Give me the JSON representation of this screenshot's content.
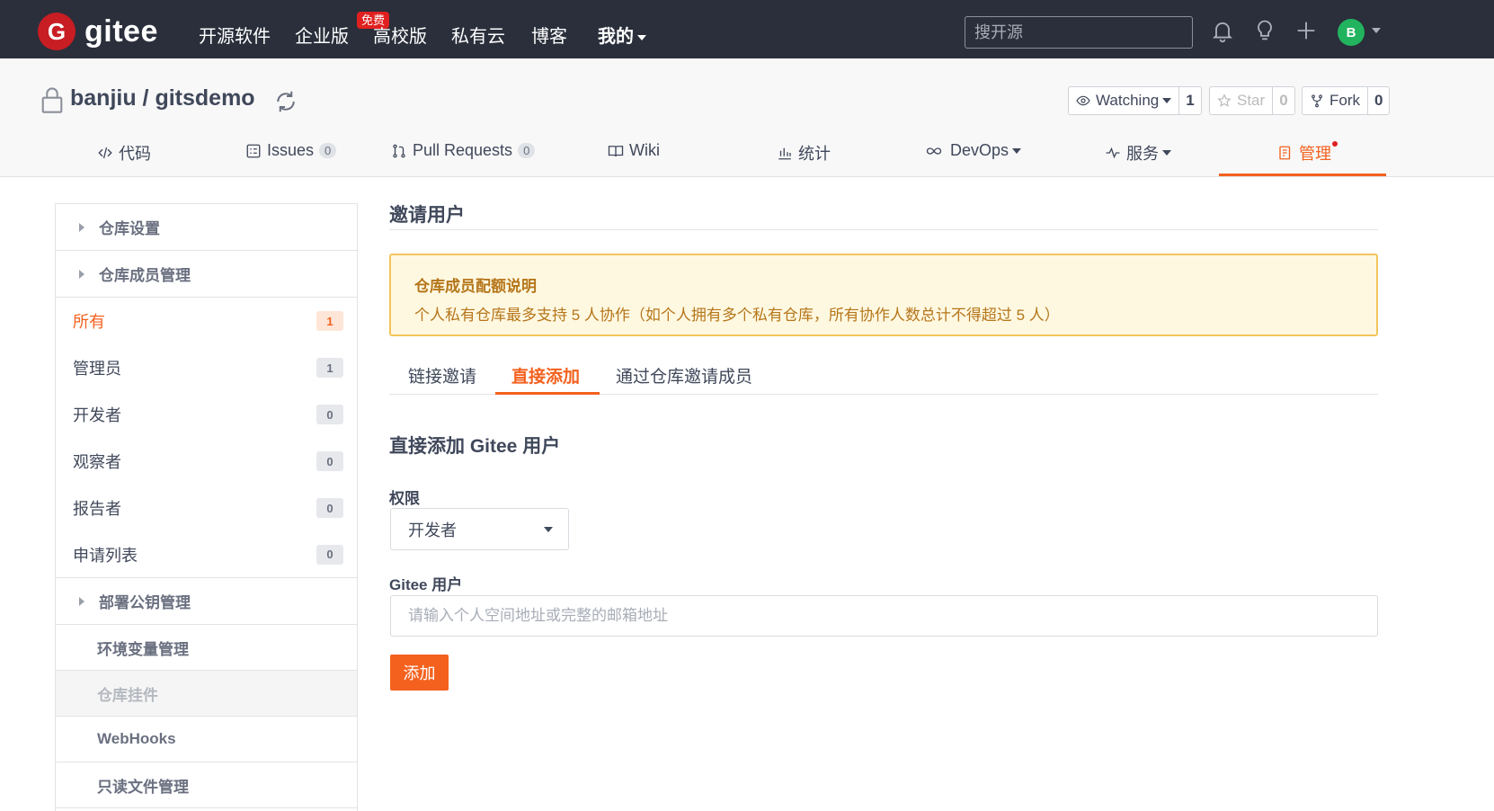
{
  "topnav": {
    "brand": "gitee",
    "logo_letter": "G",
    "items": [
      {
        "label": "开源软件"
      },
      {
        "label": "企业版"
      },
      {
        "label": "高校版"
      },
      {
        "label": "私有云"
      },
      {
        "label": "博客"
      },
      {
        "label": "我的"
      }
    ],
    "free_badge": "免费",
    "search_placeholder": "搜开源",
    "avatar_letter": "B",
    "icons": [
      "bell-icon",
      "lightbulb-icon",
      "plus-icon"
    ]
  },
  "repo": {
    "title": "banjiu / gitsdemo",
    "watch": {
      "label": "Watching",
      "count": "1"
    },
    "star": {
      "label": "Star",
      "count": "0"
    },
    "fork": {
      "label": "Fork",
      "count": "0"
    }
  },
  "tabs": [
    {
      "label": "代码"
    },
    {
      "label": "Issues",
      "count": "0"
    },
    {
      "label": "Pull Requests",
      "count": "0"
    },
    {
      "label": "Wiki"
    },
    {
      "label": "统计"
    },
    {
      "label": "DevOps"
    },
    {
      "label": "服务"
    },
    {
      "label": "管理",
      "active": true
    }
  ],
  "sidebar": {
    "sections": [
      {
        "label": "仓库设置"
      },
      {
        "label": "仓库成员管理"
      },
      {
        "label": "部署公钥管理"
      }
    ],
    "members": [
      {
        "label": "所有",
        "count": "1",
        "active": true
      },
      {
        "label": "管理员",
        "count": "1"
      },
      {
        "label": "开发者",
        "count": "0"
      },
      {
        "label": "观察者",
        "count": "0"
      },
      {
        "label": "报告者",
        "count": "0"
      },
      {
        "label": "申请列表",
        "count": "0"
      }
    ],
    "sub_items": [
      {
        "label": "环境变量管理"
      },
      {
        "label": "仓库挂件"
      },
      {
        "label": "WebHooks"
      },
      {
        "label": "只读文件管理"
      }
    ]
  },
  "main": {
    "title": "邀请用户",
    "notice": {
      "title": "仓库成员配额说明",
      "body": "个人私有仓库最多支持 5 人协作（如个人拥有多个私有仓库，所有协作人数总计不得超过 5 人）"
    },
    "subtabs": [
      {
        "label": "链接邀请"
      },
      {
        "label": "直接添加",
        "active": true
      },
      {
        "label": "通过仓库邀请成员"
      }
    ],
    "section_title": "直接添加 Gitee 用户",
    "permission_label": "权限",
    "permission_value": "开发者",
    "user_label": "Gitee 用户",
    "user_placeholder": "请输入个人空间地址或完整的邮箱地址",
    "submit_label": "添加"
  },
  "colors": {
    "topbar": "#2a2f3b",
    "brand_red": "#c71d23",
    "accent": "#f4611e",
    "notice_bg": "#fff8e1",
    "notice_border": "#f2c55c",
    "notice_text": "#b5761a"
  }
}
